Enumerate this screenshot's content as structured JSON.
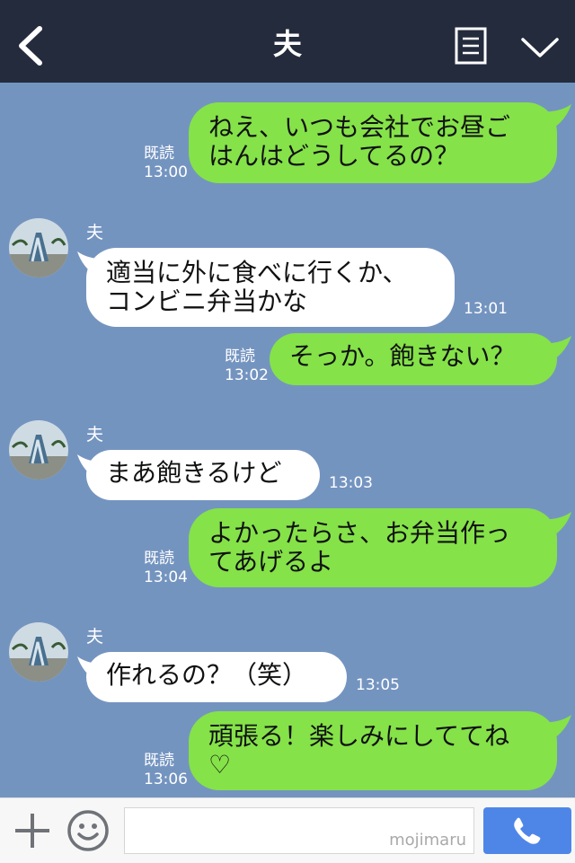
{
  "header": {
    "title": "夫"
  },
  "messages": [
    {
      "side": "me",
      "text": "ねえ、いつも会社でお昼ご\nはんはどうしてるの？",
      "read": "既読",
      "time": "13:00"
    },
    {
      "side": "them",
      "sender": "夫",
      "text": "適当に外に食べに行くか、\nコンビニ弁当かな",
      "time": "13:01"
    },
    {
      "side": "me",
      "text": "そっか。飽きない？",
      "read": "既読",
      "time": "13:02"
    },
    {
      "side": "them",
      "sender": "夫",
      "text": "まあ飽きるけど",
      "time": "13:03"
    },
    {
      "side": "me",
      "text": "よかったらさ、お弁当作っ\nてあげるよ",
      "read": "既読",
      "time": "13:04"
    },
    {
      "side": "them",
      "sender": "夫",
      "text": "作れるの？（笑）",
      "time": "13:05"
    },
    {
      "side": "me",
      "text": "頑張る！楽しみにしててね\n♡",
      "read": "既読",
      "time": "13:06"
    }
  ],
  "footer": {
    "watermark": "mojimaru"
  },
  "colors": {
    "header_bg": "#242b3d",
    "chat_bg": "#7494c0",
    "my_bubble": "#85e249",
    "their_bubble": "#ffffff",
    "call_button": "#4e86e8"
  }
}
